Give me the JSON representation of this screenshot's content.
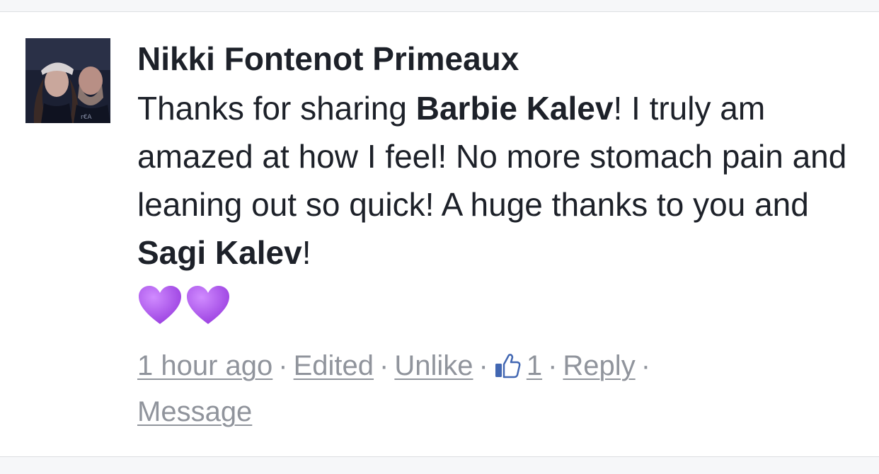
{
  "comment": {
    "author": "Nikki Fontenot Primeaux",
    "avatar_icon": "profile-photo",
    "text_parts": {
      "p1": "Thanks for sharing ",
      "mention1": "Barbie Kalev",
      "p2": "!  I truly am amazed at how I feel!  No more stomach pain and leaning out so quick! A huge thanks to you and ",
      "mention2": "Sagi Kalev",
      "p3": "!"
    },
    "emoji": [
      "purple-heart-icon",
      "purple-heart-icon"
    ],
    "emoji_color": "#a24fe0"
  },
  "meta": {
    "time": "1 hour ago",
    "edited": "Edited",
    "unlike": "Unlike",
    "like_icon": "thumbs-up-icon",
    "like_icon_color": "#4267b2",
    "like_count": "1",
    "reply": "Reply",
    "message": "Message",
    "separator": "·"
  }
}
